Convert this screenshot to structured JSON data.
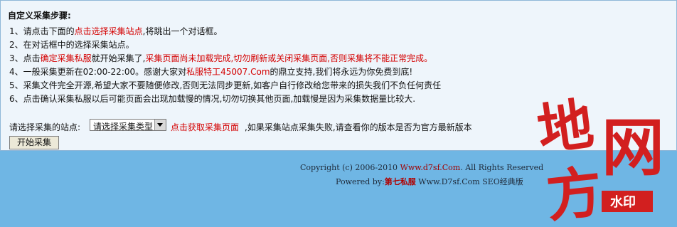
{
  "panel": {
    "title": "自定义采集步骤:",
    "steps": [
      {
        "a": "1、请点击下面的",
        "b": "点击选择采集站点",
        "c": ",将跳出一个对话框。"
      },
      {
        "a": "2、在对话框中的选择采集站点。"
      },
      {
        "a": "3、点击",
        "b": "确定采集私服",
        "c": "就开始采集了,",
        "d": "采集页面尚未加载完成,切勿刷新或关闭采集页面,否则采集将不能正常完成。"
      },
      {
        "a": "4、一般采集更新在02:00-22:00。感谢大家对",
        "b": "私服特工45007.Com",
        "c": "的鼎立支持,我们将永远为你免费到底!"
      },
      {
        "a": "5、采集文件完全开源,希望大家不要随便修改,否则无法同步更新,如客户自行修改给您带来的损失我们不负任何责任"
      },
      {
        "a": "6、点击确认采集私服以后可能页面会出现加载慢的情况,切勿切换其他页面,加载慢是因为采集数据量比较大."
      }
    ],
    "select_label": "请选择采集的站点:",
    "select_value": "请选择采集类型",
    "fetch_link": "点击获取采集页面",
    "note": ",如果采集站点采集失败,请查看你的版本是否为官方最新版本",
    "start_button": "开始采集"
  },
  "footer": {
    "copyright_a": "Copyright (c) 2006-2010 ",
    "copyright_domain": "Www.d7sf.Com",
    "copyright_b": ". All Rights Reserved",
    "powered_a": "Powered by:",
    "powered_site": "第七私服",
    "powered_b": " Www.D7sf.Com SEO经典版"
  },
  "watermark": {
    "chars": [
      "地",
      "网",
      "方"
    ],
    "badge": "水印",
    "color": "#d21f1f"
  }
}
